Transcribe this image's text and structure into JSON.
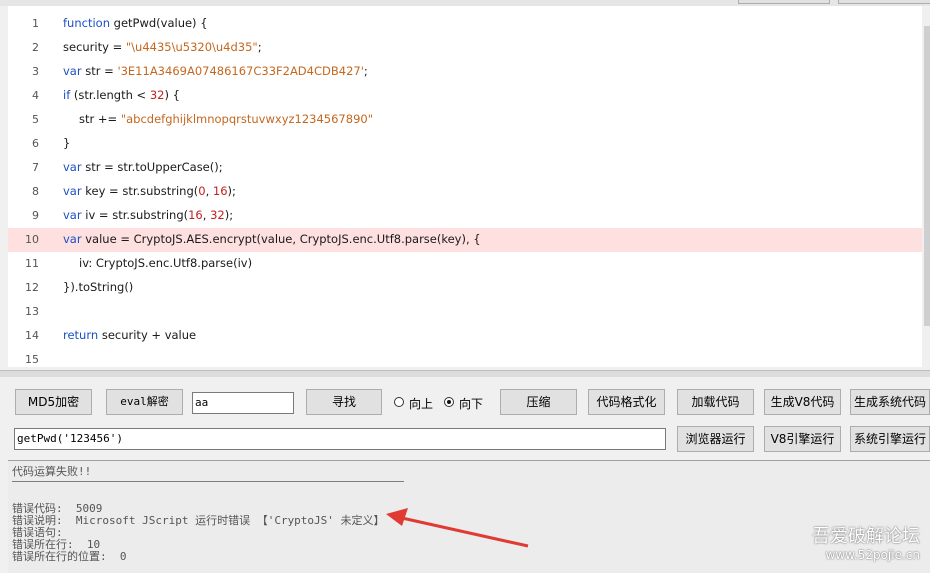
{
  "editor": {
    "lines": [
      {
        "num": "1",
        "tokens": [
          {
            "t": "function",
            "c": "kw"
          },
          {
            "t": " getPwd(value) {",
            "c": ""
          }
        ]
      },
      {
        "num": "2",
        "tokens": [
          {
            "t": "security = ",
            "c": ""
          },
          {
            "t": "\"\\u4435\\u5320\\u4d35\"",
            "c": "str"
          },
          {
            "t": ";",
            "c": ""
          }
        ]
      },
      {
        "num": "3",
        "tokens": [
          {
            "t": "var",
            "c": "kw"
          },
          {
            "t": " str = ",
            "c": ""
          },
          {
            "t": "'3E11A3469A07486167C33F2AD4CDB427'",
            "c": "str"
          },
          {
            "t": ";",
            "c": ""
          }
        ]
      },
      {
        "num": "4",
        "tokens": [
          {
            "t": "if",
            "c": "kw"
          },
          {
            "t": " (str.length < ",
            "c": ""
          },
          {
            "t": "32",
            "c": "num"
          },
          {
            "t": ") {",
            "c": ""
          }
        ]
      },
      {
        "num": "5",
        "indent": 1,
        "tokens": [
          {
            "t": "str += ",
            "c": ""
          },
          {
            "t": "\"abcdefghijklmnopqrstuvwxyz1234567890\"",
            "c": "str"
          }
        ]
      },
      {
        "num": "6",
        "tokens": [
          {
            "t": "}",
            "c": ""
          }
        ]
      },
      {
        "num": "7",
        "tokens": [
          {
            "t": "var",
            "c": "kw"
          },
          {
            "t": " str = str.toUpperCase();",
            "c": ""
          }
        ]
      },
      {
        "num": "8",
        "tokens": [
          {
            "t": "var",
            "c": "kw"
          },
          {
            "t": " key = str.substring(",
            "c": ""
          },
          {
            "t": "0",
            "c": "num"
          },
          {
            "t": ", ",
            "c": ""
          },
          {
            "t": "16",
            "c": "num"
          },
          {
            "t": ");",
            "c": ""
          }
        ]
      },
      {
        "num": "9",
        "tokens": [
          {
            "t": "var",
            "c": "kw"
          },
          {
            "t": " iv = str.substring(",
            "c": ""
          },
          {
            "t": "16",
            "c": "num"
          },
          {
            "t": ", ",
            "c": ""
          },
          {
            "t": "32",
            "c": "num"
          },
          {
            "t": ");",
            "c": ""
          }
        ]
      },
      {
        "num": "10",
        "highlight": true,
        "tokens": [
          {
            "t": "var",
            "c": "kw"
          },
          {
            "t": " value = CryptoJS.AES.encrypt(value, CryptoJS.enc.Utf8.parse(key), {",
            "c": ""
          }
        ]
      },
      {
        "num": "11",
        "indent": 1,
        "tokens": [
          {
            "t": "iv: CryptoJS.enc.Utf8.parse(iv)",
            "c": ""
          }
        ]
      },
      {
        "num": "12",
        "tokens": [
          {
            "t": "}).toString()",
            "c": ""
          }
        ]
      },
      {
        "num": "13",
        "tokens": []
      },
      {
        "num": "14",
        "tokens": [
          {
            "t": "return",
            "c": "kw"
          },
          {
            "t": " security + value",
            "c": ""
          }
        ]
      },
      {
        "num": "15",
        "tokens": []
      }
    ]
  },
  "toolbar": {
    "md5": "MD5加密",
    "eval_decrypt": "eval解密",
    "search_value": "aa",
    "find": "寻找",
    "radio_up": "向上",
    "radio_down": "向下",
    "compress": "压缩",
    "format": "代码格式化",
    "load_code": "加载代码",
    "gen_v8": "生成V8代码",
    "gen_system": "生成系统代码"
  },
  "run_row": {
    "expression": "getPwd('123456')",
    "browser_run": "浏览器运行",
    "v8_run": "V8引擎运行",
    "system_run": "系统引擎运行"
  },
  "output": {
    "status": "代码运算失败!!",
    "error_code": "错误代码:  5009",
    "error_desc": "错误说明:  Microsoft JScript 运行时错误 【'CryptoJS' 未定义】",
    "error_source": "错误语句:",
    "error_line": "错误所在行:  10",
    "error_pos": "错误所在行的位置:  0"
  },
  "annotation": {
    "arrow_color": "#e03b33"
  },
  "watermark": {
    "title": "吾爱破解论坛",
    "url": "www.52pojie.cn"
  }
}
